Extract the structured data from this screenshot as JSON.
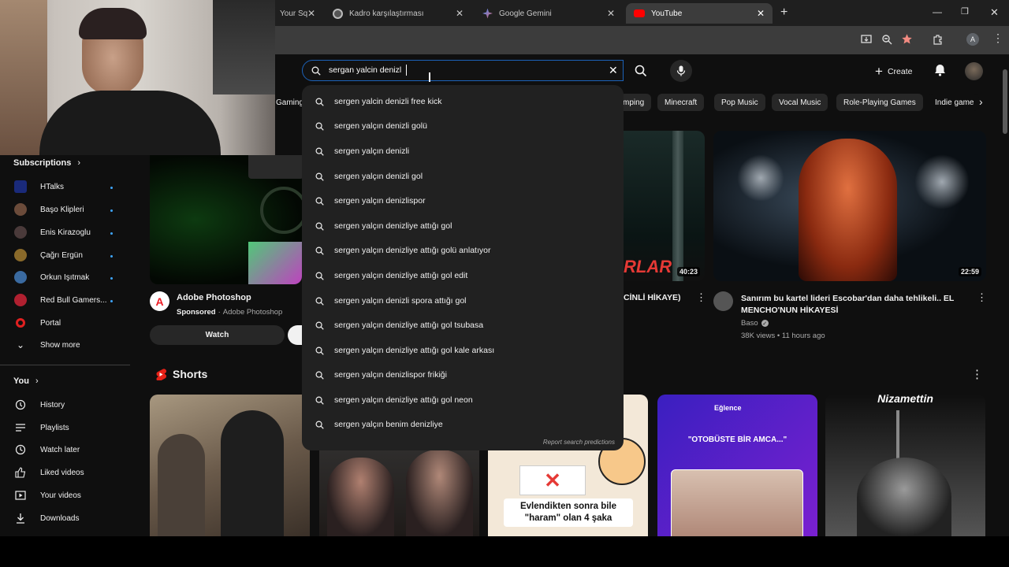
{
  "browser": {
    "tabs": [
      {
        "title": "Your Sq",
        "active": false
      },
      {
        "title": "Kadro karşılaştırması",
        "active": false
      },
      {
        "title": "Google Gemini",
        "active": false
      },
      {
        "title": "YouTube",
        "active": true
      }
    ],
    "new_tab": "+",
    "profile_initial": "A"
  },
  "search": {
    "query": "sergan yalcin denizl",
    "suggestions": [
      "sergen yalcin denizli free kick",
      "sergen yalçın denizli golü",
      "sergen yalçın denizli",
      "sergen yalçın denizli gol",
      "sergen yalçın denizlispor",
      "sergen yalçın denizliye attığı gol",
      "sergen yalçın denizliye attığı golü anlatıyor",
      "sergen yalçın denizliye attığı gol edit",
      "sergen yalçın denizli spora attığı gol",
      "sergen yalçın denizliye attığı gol tsubasa",
      "sergen yalçın denizliye attığı gol kale arkası",
      "sergen yalçın denizlispor frikiği",
      "sergen yalçın denizliye attığı gol neon",
      "sergen yalçın benim denizliye"
    ],
    "report_label": "Report search predictions"
  },
  "header": {
    "create_label": "Create"
  },
  "chips": [
    "Gaming",
    "mping",
    "Minecraft",
    "Pop Music",
    "Vocal Music",
    "Role-Playing Games",
    "Indie game"
  ],
  "sidebar": {
    "subscriptions_label": "Subscriptions",
    "channels": [
      {
        "name": "HTalks",
        "color": "#1a2a7a"
      },
      {
        "name": "Başo Klipleri",
        "color": "#6b4b3a"
      },
      {
        "name": "Enis Kirazoglu",
        "color": "#4a3a3a"
      },
      {
        "name": "Çağrı Ergün",
        "color": "#8a6a2a"
      },
      {
        "name": "Orkun Işıtmak",
        "color": "#3a6aa0"
      },
      {
        "name": "Red Bull Gamers...",
        "color": "#b02030"
      },
      {
        "name": "Portal",
        "color": "#e02020"
      }
    ],
    "show_more_label": "Show more",
    "you_label": "You",
    "you_items": [
      {
        "label": "History",
        "icon": "history-icon"
      },
      {
        "label": "Playlists",
        "icon": "playlists-icon"
      },
      {
        "label": "Watch later",
        "icon": "watch-later-icon"
      },
      {
        "label": "Liked videos",
        "icon": "liked-icon"
      },
      {
        "label": "Your videos",
        "icon": "your-videos-icon"
      },
      {
        "label": "Downloads",
        "icon": "downloads-icon"
      }
    ]
  },
  "ad": {
    "title": "Adobe Photoshop",
    "sponsored": "Sponsored",
    "advertiser": "Adobe Photoshop",
    "watch_label": "Watch"
  },
  "videos": [
    {
      "title_partial": "CİNLİ HİKAYE)",
      "duration": "40:23",
      "overlay_text": "RLAR"
    },
    {
      "title": "Sanırım bu kartel lideri Escobar'dan daha tehlikeli.. EL MENCHO'NUN HİKAYESİ",
      "channel": "Baso",
      "stats": "38K views • 11 hours ago",
      "duration": "22:59"
    }
  ],
  "shorts": {
    "label": "Shorts",
    "items": [
      {
        "overlay": ""
      },
      {
        "overlay": ""
      },
      {
        "overlay": "Evlendikten sonra bile \"haram\" olan 4 şaka"
      },
      {
        "brand": "Eğlence",
        "overlay": "\"OTOBÜSTE BİR AMCA...\""
      },
      {
        "overlay": "Nizamettin"
      }
    ]
  }
}
